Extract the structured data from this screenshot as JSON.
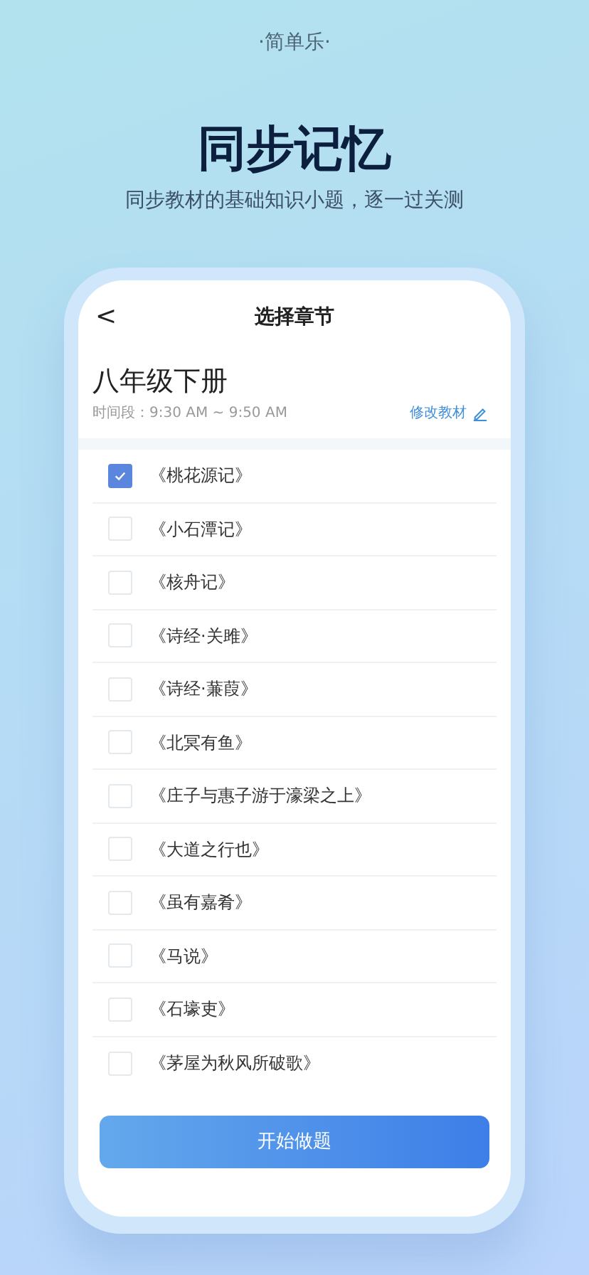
{
  "tagline": "·简单乐·",
  "headline": "同步记忆",
  "subtitle": "同步教材的基础知识小题，逐一过关测",
  "screen": {
    "back": "<",
    "title": "选择章节",
    "book": "八年级下册",
    "time": "时间段：9:30 AM ~ 9:50 AM",
    "edit": "修改教材",
    "chapters": [
      {
        "label": "《桃花源记》",
        "checked": true
      },
      {
        "label": "《小石潭记》",
        "checked": false
      },
      {
        "label": "《核舟记》",
        "checked": false
      },
      {
        "label": "《诗经·关雎》",
        "checked": false
      },
      {
        "label": "《诗经·蒹葭》",
        "checked": false
      },
      {
        "label": "《北冥有鱼》",
        "checked": false
      },
      {
        "label": "《庄子与惠子游于濠梁之上》",
        "checked": false
      },
      {
        "label": "《大道之行也》",
        "checked": false
      },
      {
        "label": "《虽有嘉肴》",
        "checked": false
      },
      {
        "label": "《马说》",
        "checked": false
      },
      {
        "label": "《石壕吏》",
        "checked": false
      },
      {
        "label": "《茅屋为秋风所破歌》",
        "checked": false
      }
    ],
    "start": "开始做题"
  }
}
